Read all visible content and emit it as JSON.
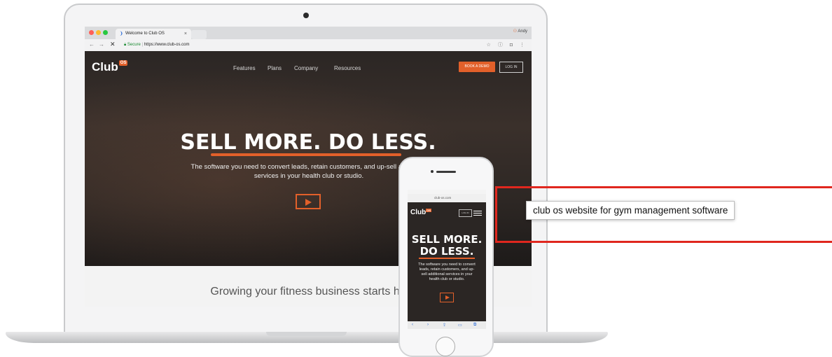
{
  "browser": {
    "tab_title": "Welcome to Club OS",
    "tab_close": "×",
    "user_name": "Andy",
    "secure_label": "Secure",
    "url": "https://www.club-os.com"
  },
  "site": {
    "logo_text": "Club",
    "logo_badge": "OS",
    "nav": [
      "Features",
      "Plans",
      "Company",
      "Resources"
    ],
    "book_demo": "BOOK A DEMO",
    "login": "LOG IN",
    "headline": "SELL MORE. DO LESS.",
    "subline_1": "The software you need to convert leads, retain customers, and up-sell additional",
    "subline_2": "services in your health club or studio.",
    "strip_text": "Growing your fitness business starts he"
  },
  "phone": {
    "address": "club-os.com",
    "headline_1": "SELL MORE.",
    "headline_2": "DO LESS.",
    "login": "LOG IN",
    "sub": [
      "The software you need to convert",
      "leads, retain customers, and up-",
      "sell additional services in your",
      "health club or studio."
    ]
  },
  "annotation": {
    "tooltip": "club os website for gym management software",
    "box_color": "#e0271e"
  },
  "colors": {
    "accent": "#e2602a"
  }
}
